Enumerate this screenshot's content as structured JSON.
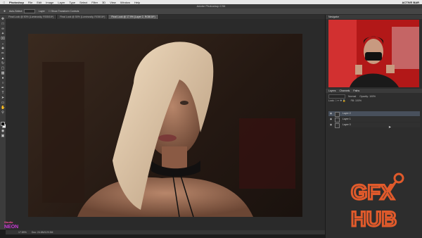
{
  "menubar": {
    "app": "Photoshop",
    "items": [
      "File",
      "Edit",
      "Image",
      "Layer",
      "Type",
      "Select",
      "Filter",
      "3D",
      "View",
      "Window",
      "Help"
    ],
    "right_label": "ACTIVE BAR"
  },
  "window": {
    "title": "Adobe Photoshop CS6"
  },
  "options": {
    "auto_select_label": "Auto-Select:",
    "auto_select_value": "Layer",
    "transform_label": "Show Transform Controls"
  },
  "tabs": [
    {
      "label": "Final Look @ 50% (Luminosity, RGB/16*)"
    },
    {
      "label": "Final Look @ 50% (Luminosity, RGB/16*)"
    },
    {
      "label": "Final Look @ 17.9% (Layer 2, RGB/16*)"
    }
  ],
  "status": {
    "zoom": "17.89%",
    "doc": "Doc: 24.8M/129.3M"
  },
  "panels": {
    "navigator_title": "Navigator",
    "layers_tabs": [
      "Layers",
      "Channels",
      "Paths"
    ],
    "blend_mode": "Normal",
    "opacity_label": "Opacity:",
    "opacity_value": "100%",
    "fill_label": "Fill:",
    "fill_value": "100%",
    "lock_label": "Lock:",
    "layers": [
      {
        "name": "Layer 2",
        "selected": true
      },
      {
        "name": "Layer 1",
        "selected": false
      },
      {
        "name": "Layer 0",
        "selected": false
      }
    ]
  },
  "watermark": {
    "line1": "GFX",
    "line2": "HUB"
  },
  "brand": {
    "line1": "Studio",
    "line2": "NEON"
  },
  "colors": {
    "accent": "#e05a2b",
    "neon": "#c93bd6",
    "navigator_bg": "#b21818"
  }
}
